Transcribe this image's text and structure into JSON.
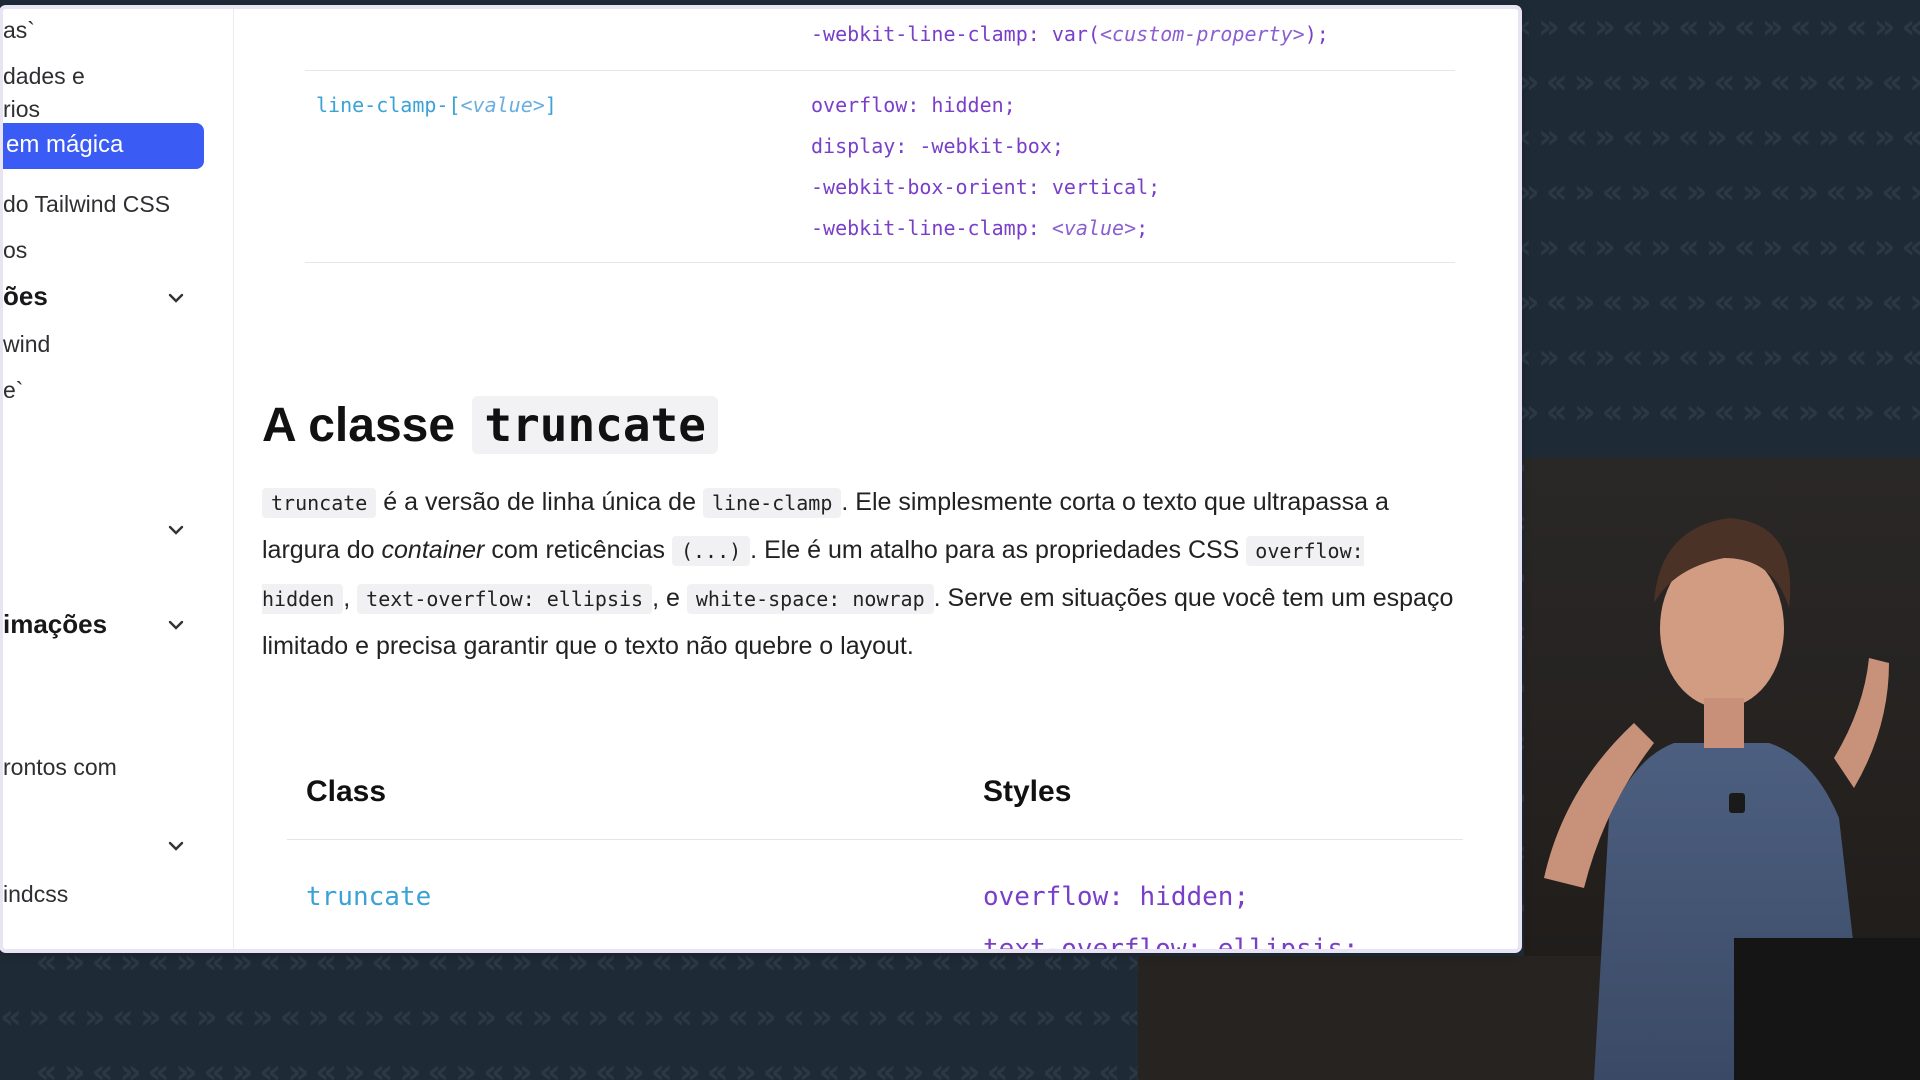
{
  "sidebar": {
    "items": [
      {
        "label": "as`"
      },
      {
        "label": "dades e"
      },
      {
        "label": "rios"
      },
      {
        "label": "em mágica",
        "active": true
      },
      {
        "label": "do Tailwind CSS"
      },
      {
        "label": "os"
      },
      {
        "label": "ões",
        "section": true
      },
      {
        "label": "wind"
      },
      {
        "label": "e`"
      },
      {
        "label": "imações",
        "section": true
      },
      {
        "label": "rontos com"
      },
      {
        "label": "indcss"
      }
    ]
  },
  "top_table": {
    "row_prev_last_style": "-webkit-line-clamp: var(",
    "row_prev_last_style_arg": "<custom-property>",
    "row_prev_last_style_end": ");",
    "row_class_prefix": "line-clamp-[",
    "row_class_arg": "<value>",
    "row_class_suffix": "]",
    "row_styles": [
      "overflow: hidden;",
      "display: -webkit-box;",
      "-webkit-box-orient: vertical;"
    ],
    "row_last_style_prefix": "-webkit-line-clamp: ",
    "row_last_style_arg": "<value>",
    "row_last_style_suffix": ";"
  },
  "section": {
    "heading_text": "A classe",
    "heading_code": "truncate",
    "para": {
      "c1": "truncate",
      "t1": " é a versão de linha única de ",
      "c2": "line-clamp",
      "t2": ". Ele simplesmente corta o texto que ultrapassa a largura do ",
      "em": "container",
      "t3": " com reticências ",
      "c3": "(...)",
      "t4": ". Ele é um atalho para as propriedades CSS ",
      "c4": "overflow: hidden",
      "t5": ", ",
      "c5": "text-overflow: ellipsis",
      "t6": ", e ",
      "c6": "white-space: nowrap",
      "t7": ". Serve em situações que você tem um espaço limitado e precisa garantir que o texto não quebre o layout."
    }
  },
  "bottom_table": {
    "header_class": "Class",
    "header_styles": "Styles",
    "row_class": "truncate",
    "row_styles": [
      "overflow: hidden;",
      "text-overflow: ellipsis;"
    ]
  },
  "colors": {
    "accent": "#3b5bf5",
    "class_blue": "#3aa2d6",
    "style_purple": "#7a3fc9",
    "background": "#1e2a36"
  }
}
